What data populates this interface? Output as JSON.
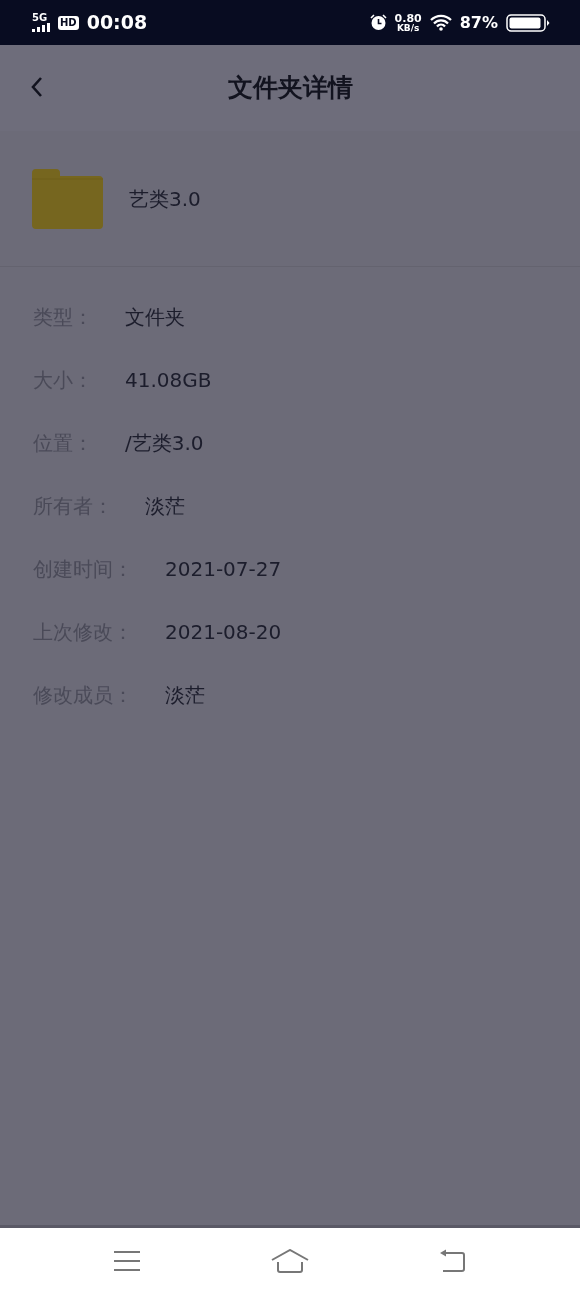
{
  "status_bar": {
    "network": "5G",
    "hd": "HD",
    "time": "00:08",
    "speed_value": "0.80",
    "speed_unit": "KB/s",
    "battery": "87%"
  },
  "header": {
    "title": "文件夹详情"
  },
  "folder": {
    "name": "艺类3.0"
  },
  "details": [
    {
      "label": "类型：",
      "value": "文件夹"
    },
    {
      "label": "大小：",
      "value": "41.08GB"
    },
    {
      "label": "位置：",
      "value": "/艺类3.0"
    },
    {
      "label": "所有者：",
      "value": "淡茫"
    },
    {
      "label": "创建时间：",
      "value": "2021-07-27"
    },
    {
      "label": "上次修改：",
      "value": "2021-08-20"
    },
    {
      "label": "修改成员：",
      "value": "淡茫"
    }
  ]
}
